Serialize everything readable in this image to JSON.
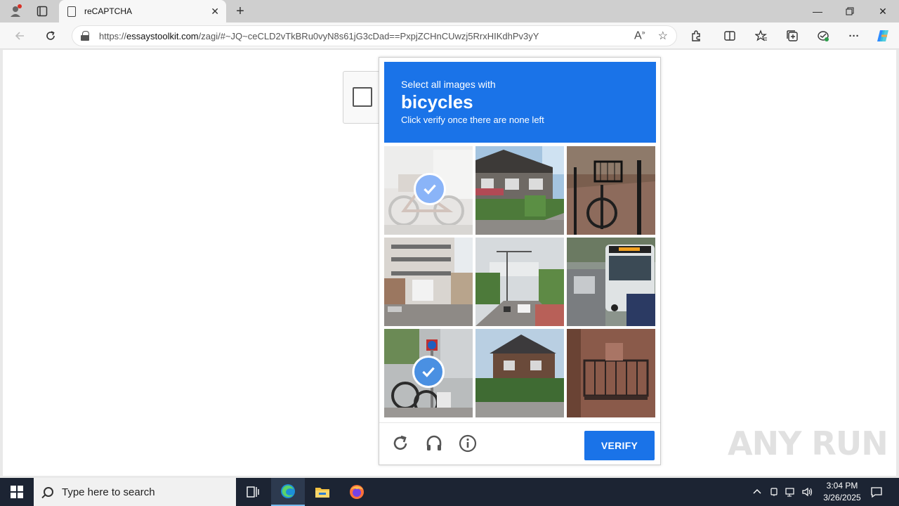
{
  "browser": {
    "tab_title": "reCAPTCHA",
    "url_prefix": "https://",
    "url_domain": "essaystoolkit.com",
    "url_path": "/zagi/#~JQ~ceCLD2vTkBRu0vyN8s61jG3cDad==PxpjZCHnCUwzj5RrxHIKdhPv3yY"
  },
  "captcha": {
    "instruction": "Select all images with",
    "keyword": "bicycles",
    "sub_instruction": "Click verify once there are none left",
    "verify_label": "VERIFY",
    "tiles": [
      {
        "index": 1,
        "selected": true
      },
      {
        "index": 2,
        "selected": false
      },
      {
        "index": 3,
        "selected": false
      },
      {
        "index": 4,
        "selected": false
      },
      {
        "index": 5,
        "selected": false
      },
      {
        "index": 6,
        "selected": false
      },
      {
        "index": 7,
        "selected": true
      },
      {
        "index": 8,
        "selected": false
      },
      {
        "index": 9,
        "selected": false
      }
    ],
    "accent_color": "#1a73e8"
  },
  "watermark": "ANY RUN",
  "taskbar": {
    "search_placeholder": "Type here to search",
    "time": "3:04 PM",
    "date": "3/26/2025"
  }
}
